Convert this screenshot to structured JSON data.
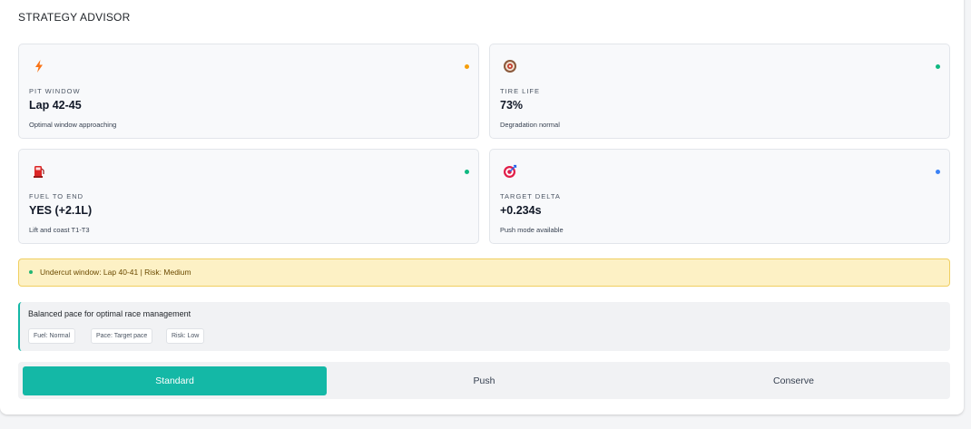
{
  "title": "STRATEGY ADVISOR",
  "cards": [
    {
      "icon": "lightning-icon",
      "label": "PIT WINDOW",
      "value": "Lap 42-45",
      "note": "Optimal window approaching",
      "dot_color": "#f59e0b"
    },
    {
      "icon": "tire-icon",
      "label": "TIRE LIFE",
      "value": "73%",
      "note": "Degradation normal",
      "dot_color": "#10b981"
    },
    {
      "icon": "fuel-pump-icon",
      "label": "FUEL TO END",
      "value": "YES (+2.1L)",
      "note": "Lift and coast T1-T3",
      "dot_color": "#10b981"
    },
    {
      "icon": "target-icon",
      "label": "TARGET DELTA",
      "value": "+0.234s",
      "note": "Push mode available",
      "dot_color": "#3b82f6"
    }
  ],
  "alert": {
    "text": "Undercut window: Lap 40-41 | Risk: Medium",
    "dot_color": "#22b573"
  },
  "mode_info": {
    "description": "Balanced pace for optimal race management",
    "chips": [
      "Fuel: Normal",
      "Pace: Target pace",
      "Risk: Low"
    ]
  },
  "modes": {
    "standard": "Standard",
    "push": "Push",
    "conserve": "Conserve",
    "active": "Standard"
  },
  "colors": {
    "accent": "#14b8a6",
    "alert_bg": "#fdf1c5",
    "alert_border": "#f0cf61"
  }
}
